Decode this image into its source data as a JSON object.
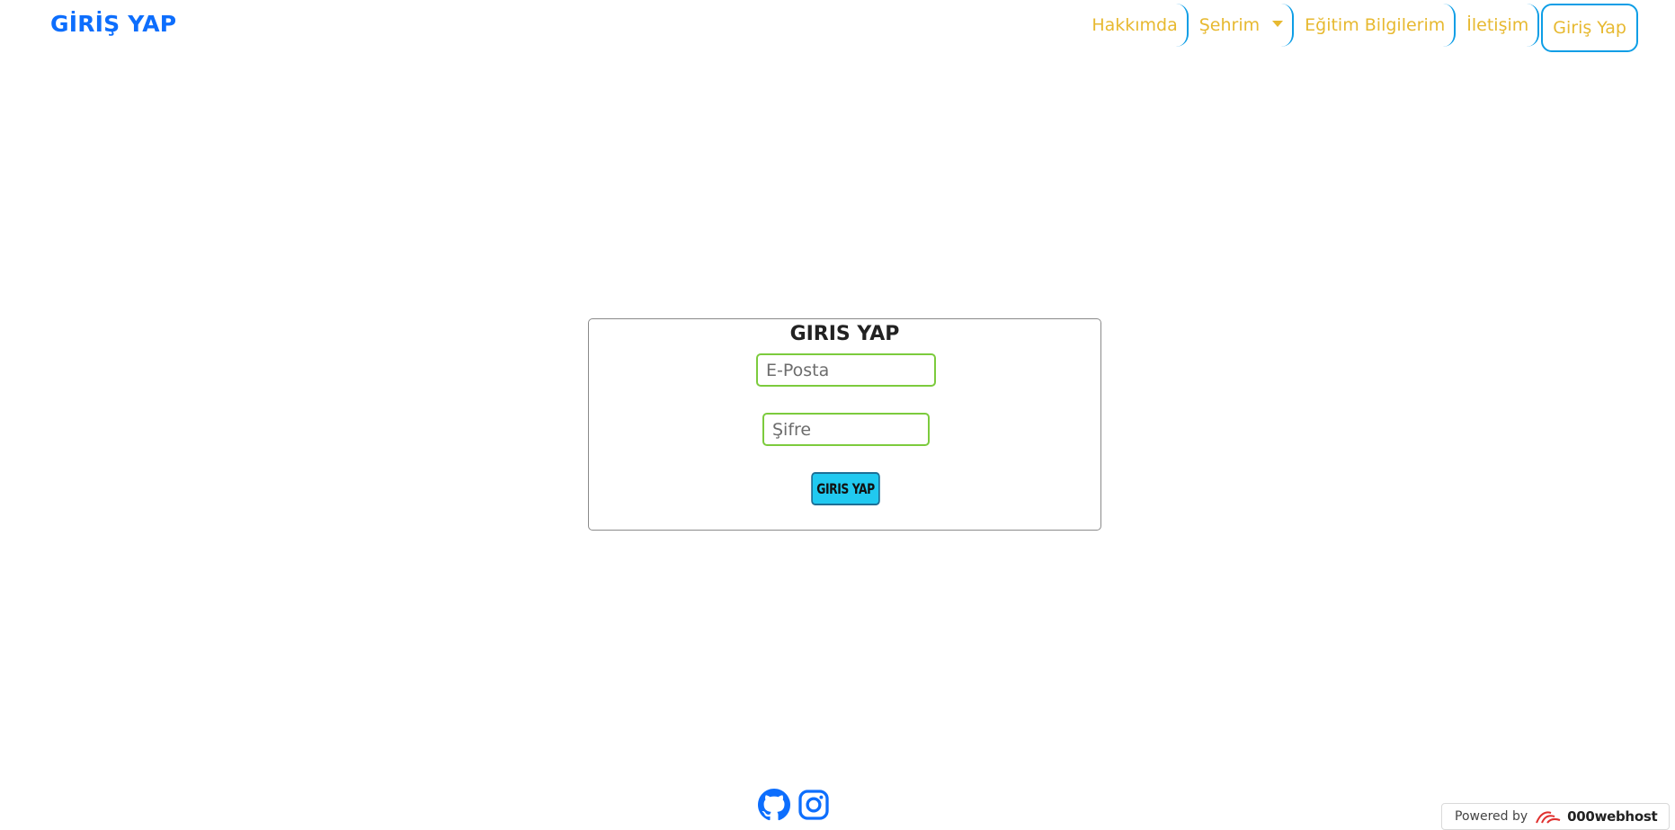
{
  "navbar": {
    "brand": "GİRİŞ YAP",
    "items": [
      {
        "label": "Hakkımda"
      },
      {
        "label": "Şehrim",
        "has_dropdown": true
      },
      {
        "label": "Eğitim Bilgilerim"
      },
      {
        "label": "İletişim"
      },
      {
        "label": "Giriş Yap",
        "active": true
      }
    ]
  },
  "login": {
    "title": "GIRIS YAP",
    "email_placeholder": "E-Posta",
    "email_value": "",
    "password_placeholder": "Şifre",
    "password_value": "",
    "submit_label": "GIRIS YAP"
  },
  "footer": {
    "icons": [
      "github-icon",
      "instagram-icon"
    ]
  },
  "powered_by": {
    "label": "Powered by",
    "brand": "000webhost"
  },
  "colors": {
    "brand": "#0d6efd",
    "nav_text": "#e7b930",
    "nav_border": "#0d9ee6",
    "field_border": "#7ccb3d",
    "button_bg": "#21c9f0",
    "icon": "#0d6efd"
  }
}
